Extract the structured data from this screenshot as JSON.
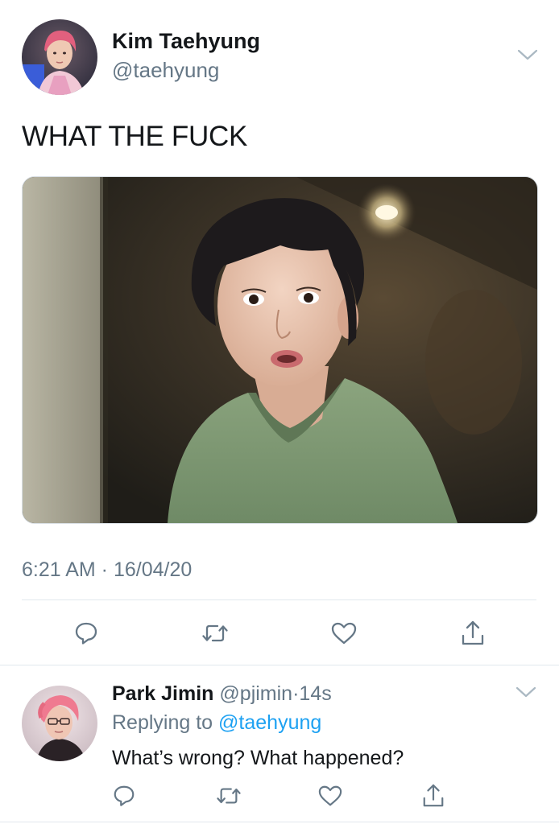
{
  "tweet": {
    "author": {
      "name": "Kim Taehyung",
      "handle": "@taehyung",
      "avatar_icon": "profile-photo-pink-hair"
    },
    "text": "WHAT THE FUCK",
    "media": {
      "icon": "photo-surprised-person-green-shirt"
    },
    "timestamp": "6:21 AM · 16/04/20",
    "actions": [
      {
        "name": "reply",
        "icon": "speech-bubble-icon"
      },
      {
        "name": "retweet",
        "icon": "retweet-icon"
      },
      {
        "name": "like",
        "icon": "heart-icon"
      },
      {
        "name": "share",
        "icon": "share-icon"
      }
    ]
  },
  "reply": {
    "author": {
      "name": "Park Jimin",
      "handle": "@pjimin",
      "avatar_icon": "profile-photo-pink-hair-glasses"
    },
    "separator": "·",
    "time": "14s",
    "replying_label": "Replying to",
    "replying_to": "@taehyung",
    "text": "What’s wrong? What happened?",
    "actions": [
      {
        "name": "reply",
        "icon": "speech-bubble-icon"
      },
      {
        "name": "retweet",
        "icon": "retweet-icon"
      },
      {
        "name": "like",
        "icon": "heart-icon"
      },
      {
        "name": "share",
        "icon": "share-icon"
      }
    ]
  },
  "colors": {
    "primary_text": "#14171a",
    "secondary_text": "#657786",
    "link": "#1da1f2",
    "divider": "#e1e8ed",
    "icon": "#657786"
  }
}
